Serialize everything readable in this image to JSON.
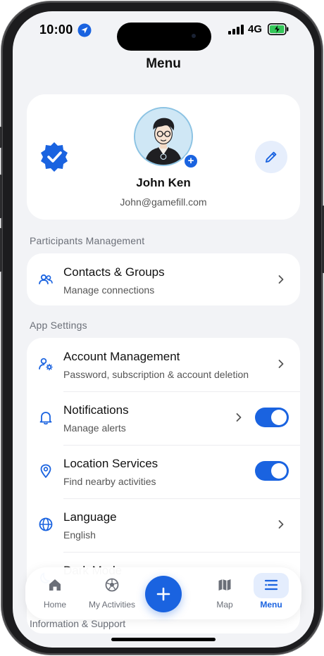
{
  "status": {
    "time": "10:00",
    "network": "4G"
  },
  "header": {
    "title": "Menu"
  },
  "profile": {
    "name": "John Ken",
    "email": "John@gamefill.com"
  },
  "sections": {
    "participants": {
      "label": "Participants Management",
      "items": [
        {
          "title": "Contacts & Groups",
          "subtitle": "Manage connections",
          "icon": "people-icon"
        }
      ]
    },
    "app_settings": {
      "label": "App Settings",
      "items": [
        {
          "title": "Account Management",
          "subtitle": "Password, subscription & account deletion",
          "icon": "user-gear-icon"
        },
        {
          "title": "Notifications",
          "subtitle": "Manage alerts",
          "icon": "bell-icon",
          "toggle": true
        },
        {
          "title": "Location Services",
          "subtitle": "Find nearby activities",
          "icon": "location-pin-icon",
          "toggle": true
        },
        {
          "title": "Language",
          "subtitle": "English",
          "icon": "globe-icon"
        },
        {
          "title": "Dark Mode",
          "subtitle": "",
          "icon": "moon-icon"
        }
      ]
    },
    "info_support": {
      "label": "Information & Support"
    }
  },
  "tabbar": {
    "tabs": [
      {
        "label": "Home",
        "icon": "home-icon"
      },
      {
        "label": "My Activities",
        "icon": "ball-icon"
      },
      {
        "label": "Map",
        "icon": "map-icon"
      },
      {
        "label": "Menu",
        "icon": "menu-list-icon",
        "active": true
      }
    ],
    "fab_icon": "plus-icon"
  },
  "colors": {
    "accent": "#1a63e0",
    "background": "#f2f3f6",
    "card": "#ffffff"
  }
}
